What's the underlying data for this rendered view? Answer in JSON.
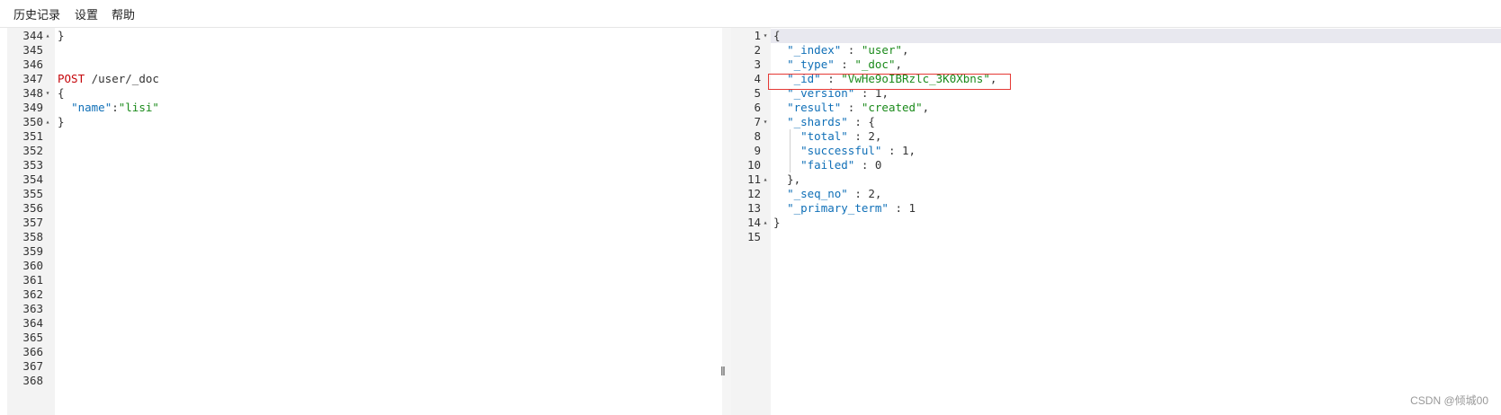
{
  "menu": {
    "history": "历史记录",
    "settings": "设置",
    "help": "帮助"
  },
  "left_editor": {
    "lines": [
      {
        "num": "344",
        "fold": "up",
        "text": "}"
      },
      {
        "num": "345",
        "text": ""
      },
      {
        "num": "346",
        "text": ""
      },
      {
        "num": "347",
        "method": "POST",
        "path": " /user/_doc"
      },
      {
        "num": "348",
        "fold": "down",
        "text": "{"
      },
      {
        "num": "349",
        "key": "\"name\"",
        "sep": ":",
        "value": "\"lisi\""
      },
      {
        "num": "350",
        "fold": "up",
        "text": "}"
      },
      {
        "num": "351",
        "text": ""
      },
      {
        "num": "352",
        "text": ""
      },
      {
        "num": "353",
        "text": ""
      },
      {
        "num": "354",
        "text": ""
      },
      {
        "num": "355",
        "text": ""
      },
      {
        "num": "356",
        "text": ""
      },
      {
        "num": "357",
        "text": ""
      },
      {
        "num": "358",
        "text": ""
      },
      {
        "num": "359",
        "text": ""
      },
      {
        "num": "360",
        "text": ""
      },
      {
        "num": "361",
        "text": ""
      },
      {
        "num": "362",
        "text": ""
      },
      {
        "num": "363",
        "text": ""
      },
      {
        "num": "364",
        "text": ""
      },
      {
        "num": "365",
        "text": ""
      },
      {
        "num": "366",
        "text": ""
      },
      {
        "num": "367",
        "text": ""
      },
      {
        "num": "368",
        "text": ""
      }
    ]
  },
  "right_editor": {
    "lines": [
      {
        "num": "1",
        "fold": "down",
        "text": "{"
      },
      {
        "num": "2",
        "key": "\"_index\"",
        "sep": " : ",
        "value": "\"user\"",
        "end": ","
      },
      {
        "num": "3",
        "key": "\"_type\"",
        "sep": " : ",
        "value": "\"_doc\"",
        "end": ","
      },
      {
        "num": "4",
        "key": "\"_id\"",
        "sep": " : ",
        "value": "\"VwHe9oIBRzlc_3K0Xbns\"",
        "end": ","
      },
      {
        "num": "5",
        "key": "\"_version\"",
        "sep": " : ",
        "num_value": "1",
        "end": ","
      },
      {
        "num": "6",
        "key": "\"result\"",
        "sep": " : ",
        "value": "\"created\"",
        "end": ","
      },
      {
        "num": "7",
        "fold": "down",
        "key": "\"_shards\"",
        "sep": " : ",
        "end": "{"
      },
      {
        "num": "8",
        "key": "\"total\"",
        "sep": " : ",
        "num_value": "2",
        "end": ",",
        "deep": true
      },
      {
        "num": "9",
        "key": "\"successful\"",
        "sep": " : ",
        "num_value": "1",
        "end": ",",
        "deep": true
      },
      {
        "num": "10",
        "key": "\"failed\"",
        "sep": " : ",
        "num_value": "0",
        "end": "",
        "deep": true
      },
      {
        "num": "11",
        "fold": "up",
        "text": "  },"
      },
      {
        "num": "12",
        "key": "\"_seq_no\"",
        "sep": " : ",
        "num_value": "2",
        "end": ","
      },
      {
        "num": "13",
        "key": "\"_primary_term\"",
        "sep": " : ",
        "num_value": "1",
        "end": ""
      },
      {
        "num": "14",
        "fold": "up",
        "text": "}"
      },
      {
        "num": "15",
        "text": ""
      }
    ]
  },
  "splitter_glyph": "‖",
  "watermark": "CSDN @倾城00",
  "colors": {
    "keyword": "#c5060b",
    "key": "#0f6fb7",
    "string": "#1a8a1a",
    "highlight_border": "#e53935"
  }
}
